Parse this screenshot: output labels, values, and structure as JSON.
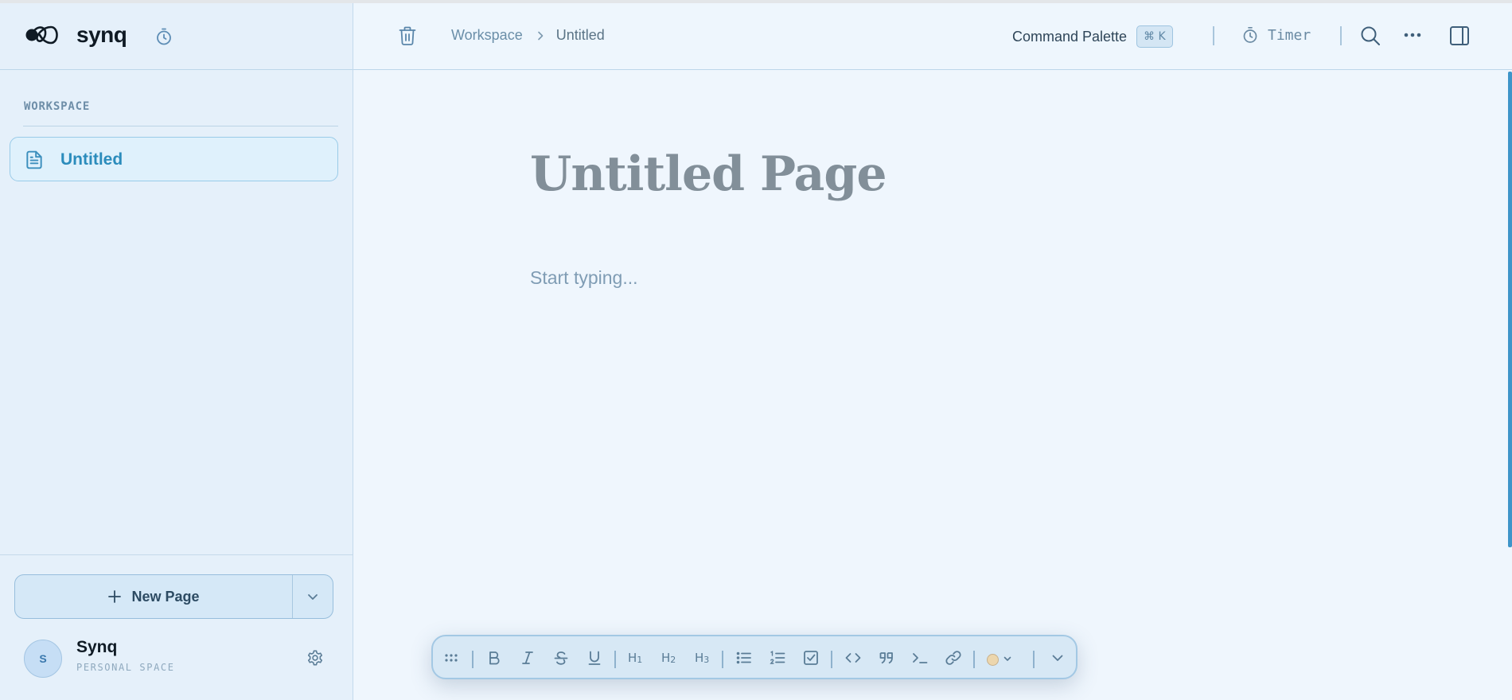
{
  "app": {
    "brand": "synq",
    "colors": {
      "accent": "#2b8cbc",
      "sidebar_bg": "#e5f0fa",
      "main_bg": "#eff6fd",
      "toolbar_bg": "#d7e8f5"
    }
  },
  "sidebar": {
    "section_label": "WORKSPACE",
    "pages": [
      {
        "label": "Untitled",
        "icon": "document-icon",
        "active": true
      }
    ],
    "new_page_label": "New Page",
    "user": {
      "initial": "S",
      "name": "Synq",
      "subtitle": "PERSONAL SPACE"
    }
  },
  "topbar": {
    "breadcrumb": {
      "root": "Workspace",
      "current": "Untitled"
    },
    "command_palette_label": "Command Palette",
    "command_palette_shortcut": "⌘ K",
    "timer_label": "Timer"
  },
  "editor": {
    "title": "Untitled Page",
    "body_placeholder": "Start typing..."
  },
  "toolbar": {
    "h1_label": "H",
    "h1_sub": "1",
    "h2_label": "H",
    "h2_sub": "2",
    "h3_label": "H",
    "h3_sub": "3",
    "text_color": "#ecd6ad"
  }
}
